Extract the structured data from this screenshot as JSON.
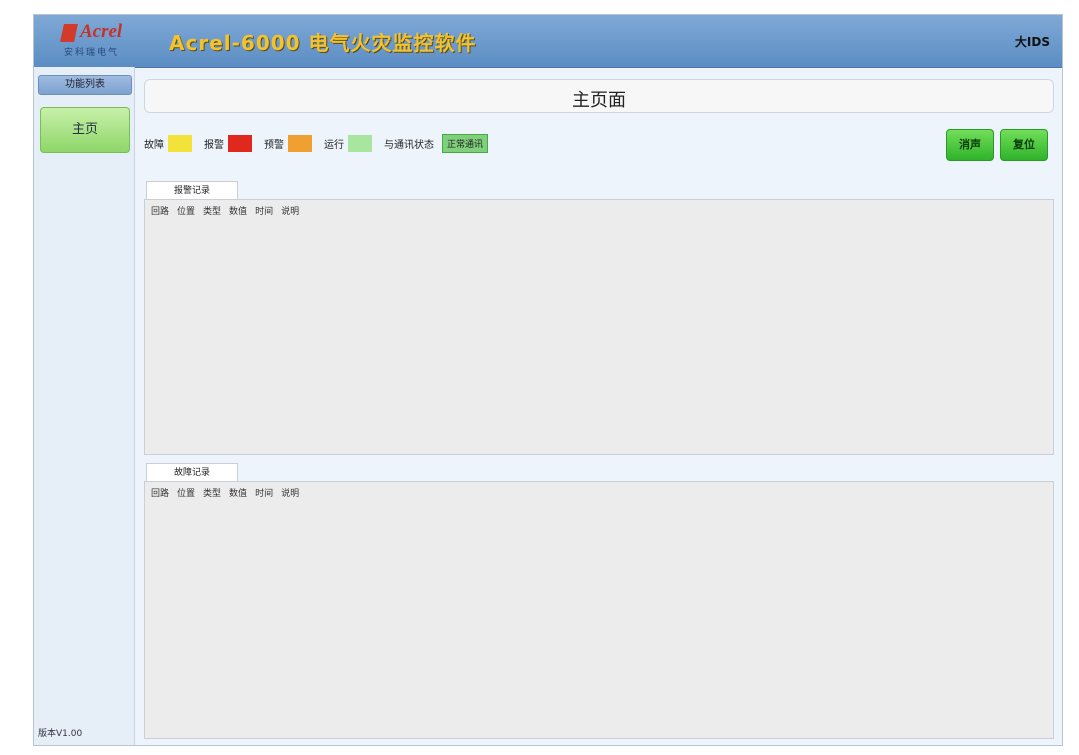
{
  "header": {
    "logo": "Acrel",
    "logo_sub": "安科瑞电气",
    "title": "Acrel-6000 电气火灾监控软件",
    "user": "大IDS"
  },
  "sidebar": {
    "section_label": "功能列表",
    "main_item": "主页",
    "version": "版本V1.00"
  },
  "page": {
    "title": "主页面"
  },
  "legend": [
    {
      "label": "故障",
      "color": "#f2e23a"
    },
    {
      "label": "报警",
      "color": "#e0281f"
    },
    {
      "label": "预警",
      "color": "#f0a030"
    },
    {
      "label": "运行",
      "color": "#a8e6a0"
    }
  ],
  "network": {
    "label": "与通讯状态",
    "value": "正常通讯"
  },
  "buttons": {
    "silence": "消声",
    "reset": "复位"
  },
  "panels": [
    {
      "tab": "报警记录",
      "columns": [
        "回路",
        "位置",
        "类型",
        "数值",
        "时间",
        "说明"
      ]
    },
    {
      "tab": "故障记录",
      "columns": [
        "回路",
        "位置",
        "类型",
        "数值",
        "时间",
        "说明"
      ]
    }
  ]
}
